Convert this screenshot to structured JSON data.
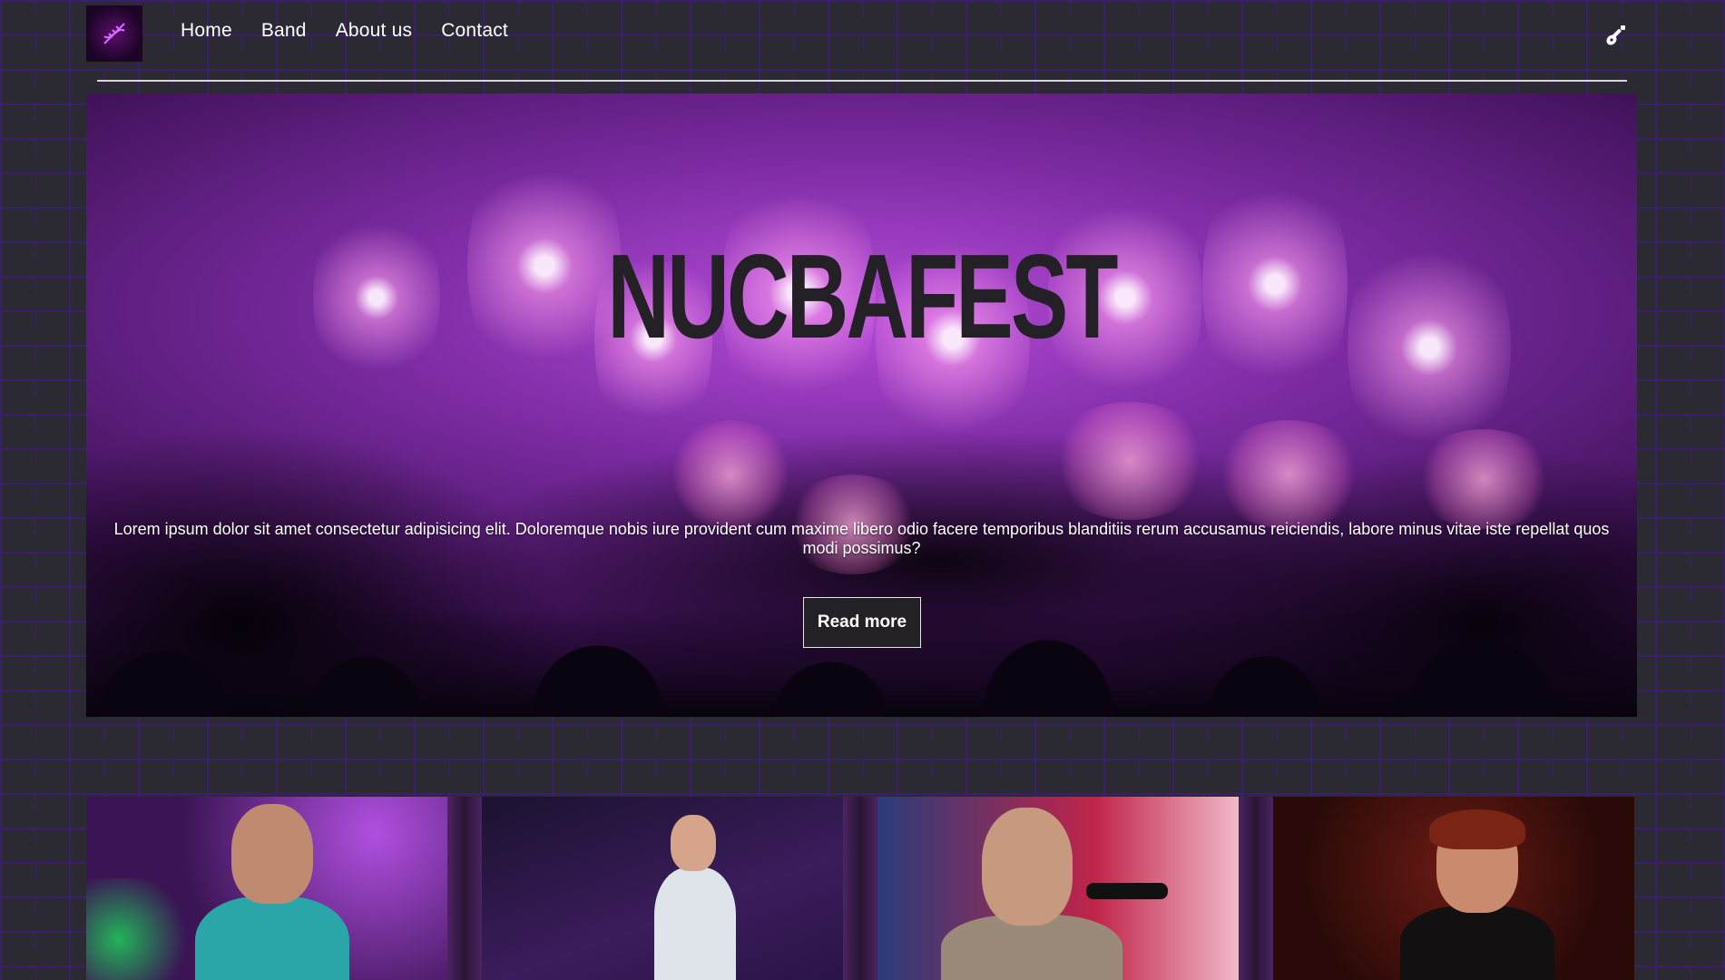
{
  "nav": {
    "logo_icon": "dna-helix-icon",
    "links": [
      "Home",
      "Band",
      "About us",
      "Contact"
    ],
    "cart_icon": "guitar-icon"
  },
  "hero": {
    "title": "NUCBAFEST",
    "text": "Lorem ipsum dolor sit amet consectetur adipisicing elit. Doloremque nobis iure provident cum maxime libero odio facere temporibus blanditiis rerum accusamus reiciendis, labore minus vitae iste repellat quos modi possimus?",
    "button_label": "Read more"
  },
  "band": {
    "members": [
      {
        "photo": "singer-with-guitar-photo"
      },
      {
        "photo": "singer-white-shirt-photo"
      },
      {
        "photo": "singer-microphone-photo"
      },
      {
        "photo": "young-man-portrait-photo"
      }
    ]
  },
  "colors": {
    "accent": "#7c2ba3",
    "background": "#2b2a33",
    "brick_lines": "#3b1f6e",
    "button_bg": "#232126"
  }
}
